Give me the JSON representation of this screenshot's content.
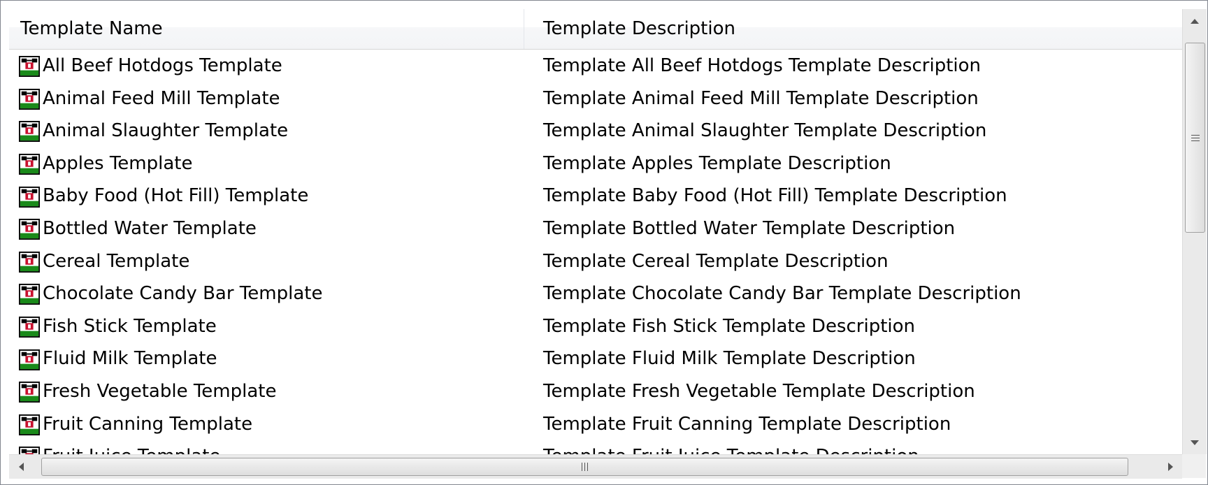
{
  "columns": {
    "name": "Template Name",
    "description": "Template Description"
  },
  "rows": [
    {
      "name": "All Beef Hotdogs Template",
      "description": "Template All Beef Hotdogs Template Description"
    },
    {
      "name": "Animal Feed Mill Template",
      "description": "Template Animal Feed Mill Template Description"
    },
    {
      "name": "Animal Slaughter Template",
      "description": "Template Animal Slaughter Template Description"
    },
    {
      "name": "Apples Template",
      "description": "Template Apples Template Description"
    },
    {
      "name": "Baby Food (Hot Fill) Template",
      "description": "Template Baby Food (Hot Fill) Template Description"
    },
    {
      "name": "Bottled Water Template",
      "description": "Template Bottled Water Template Description"
    },
    {
      "name": "Cereal Template",
      "description": "Template Cereal Template Description"
    },
    {
      "name": "Chocolate Candy Bar Template",
      "description": "Template Chocolate Candy Bar Template Description"
    },
    {
      "name": "Fish Stick Template",
      "description": "Template Fish Stick Template Description"
    },
    {
      "name": "Fluid Milk Template",
      "description": "Template Fluid Milk Template Description"
    },
    {
      "name": "Fresh Vegetable Template",
      "description": "Template Fresh Vegetable Template Description"
    },
    {
      "name": "Fruit Canning Template",
      "description": "Template Fruit Canning Template Description"
    },
    {
      "name": "Fruit Juice Template",
      "description": "Template Fruit Juice Template Description"
    }
  ],
  "icons": {
    "row_icon": "template-icon",
    "scroll_up": "arrow-up-icon",
    "scroll_down": "arrow-down-icon",
    "scroll_left": "arrow-left-icon",
    "scroll_right": "arrow-right-icon"
  },
  "scroll": {
    "vertical_thumb_position": 0.0,
    "horizontal_thumb_position": 0.0
  }
}
